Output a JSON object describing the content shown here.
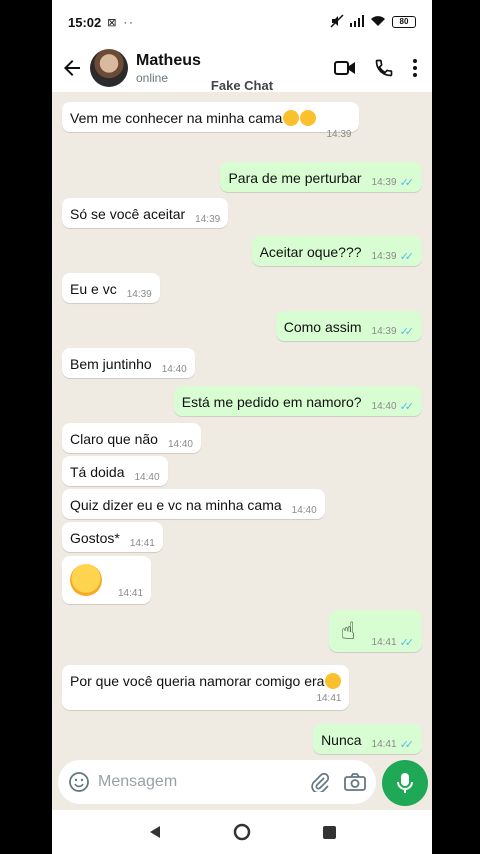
{
  "status_bar": {
    "time": "15:02",
    "left_icons": "⊠ ··",
    "battery": "80"
  },
  "header": {
    "contact_name": "Matheus",
    "contact_status": "online",
    "watermark": "Fake Chat"
  },
  "messages": [
    {
      "dir": "in",
      "text": "Vem me conhecer na minha cama",
      "time": "14:39"
    },
    {
      "dir": "out",
      "text": "Para de me perturbar",
      "time": "14:39"
    },
    {
      "dir": "in",
      "text": "Só se você aceitar",
      "time": "14:39"
    },
    {
      "dir": "out",
      "text": "Aceitar oque???",
      "time": "14:39"
    },
    {
      "dir": "in",
      "text": "Eu e vc",
      "time": "14:39"
    },
    {
      "dir": "out",
      "text": "Como assim",
      "time": "14:39"
    },
    {
      "dir": "in",
      "text": "Bem juntinho",
      "time": "14:40"
    },
    {
      "dir": "out",
      "text": "Está me pedido em namoro?",
      "time": "14:40"
    },
    {
      "dir": "in",
      "text": "Claro que não",
      "time": "14:40"
    },
    {
      "dir": "in",
      "text": "Tá doida",
      "time": "14:40"
    },
    {
      "dir": "in",
      "text": "Quiz dizer eu e vc na minha cama",
      "time": "14:40"
    },
    {
      "dir": "in",
      "text": "Gostos*",
      "time": "14:41"
    },
    {
      "dir": "in",
      "text": "",
      "time": "14:41"
    },
    {
      "dir": "out",
      "text": "",
      "time": "14:41"
    },
    {
      "dir": "in",
      "text": "Por que você queria namorar comigo era",
      "time": "14:41"
    },
    {
      "dir": "out",
      "text": "Nunca",
      "time": "14:41"
    }
  ],
  "input": {
    "placeholder": "Mensagem"
  },
  "colors": {
    "incoming": "#ffffff",
    "outgoing": "#d9fdd3",
    "read_ticks": "#53bdeb",
    "accent": "#1fa855"
  }
}
